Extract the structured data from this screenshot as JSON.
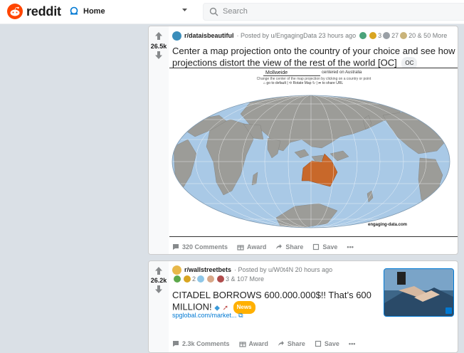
{
  "header": {
    "logo_text": "reddit",
    "home_label": "Home",
    "search_placeholder": "Search"
  },
  "posts": [
    {
      "score": "26.5k",
      "subreddit": "r/dataisbeautiful",
      "posted_by": "· Posted by u/EngagingData 23 hours ago",
      "award_count_1": "3",
      "award_count_2": "27",
      "award_more": "20 & 50 More",
      "title": "Center a map projection onto the country of your choice and see how projections distort the view of the rest of the world [OC]",
      "flair": "OC",
      "map": {
        "projection": "Mollweide",
        "centered_on": "centered on Australia",
        "help": "Change the center of the map projection by clicking on a country or point",
        "go_default": "go to default",
        "rotate": "Rotate Map",
        "share": "to share URL",
        "credit": "engaging-data.com"
      },
      "comments": "320 Comments",
      "award": "Award",
      "share": "Share",
      "save": "Save"
    },
    {
      "score": "26.2k",
      "subreddit": "r/wallstreetbets",
      "posted_by": "· Posted by u/W0t4N 20 hours ago",
      "award_count_1": "2",
      "award_more": "3 & 107 More",
      "title": "CITADEL BORROWS 600.000.000$!! That’s 600 MILLION!",
      "flair": "News",
      "link": "spglobal.com/market...",
      "comments": "2.3k Comments",
      "award": "Award",
      "share": "Share",
      "save": "Save"
    }
  ],
  "colors": {
    "reddit_orange": "#ff4500",
    "link_blue": "#0079d3",
    "ocean": "#a9c9e6",
    "land": "#9c9c98",
    "highlight": "#c8682a"
  }
}
